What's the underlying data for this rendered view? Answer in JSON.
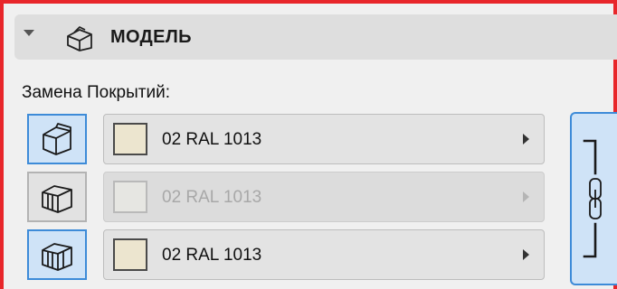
{
  "panel": {
    "title": "МОДЕЛЬ",
    "icon": "model-box-icon",
    "expanded": true
  },
  "override_surfaces": {
    "label": "Замена Покрытий:",
    "rows": [
      {
        "surface_icon": "top-surface-icon",
        "surface_active": true,
        "material_name": "02 RAL 1013",
        "swatch_color": "#ece5cf",
        "enabled": true
      },
      {
        "surface_icon": "side-surface-icon",
        "surface_active": false,
        "material_name": "02 RAL 1013",
        "swatch_color": "#e6e6e2",
        "enabled": false
      },
      {
        "surface_icon": "other-surface-icon",
        "surface_active": true,
        "material_name": "02 RAL 1013",
        "swatch_color": "#ece5cf",
        "enabled": true
      }
    ],
    "link_toggle": {
      "icon": "chain-link-icon",
      "active": true
    }
  },
  "colors": {
    "frame_border": "#e8262a",
    "active_blue": "#3d8bd8",
    "active_fill": "#cfe3f7"
  }
}
